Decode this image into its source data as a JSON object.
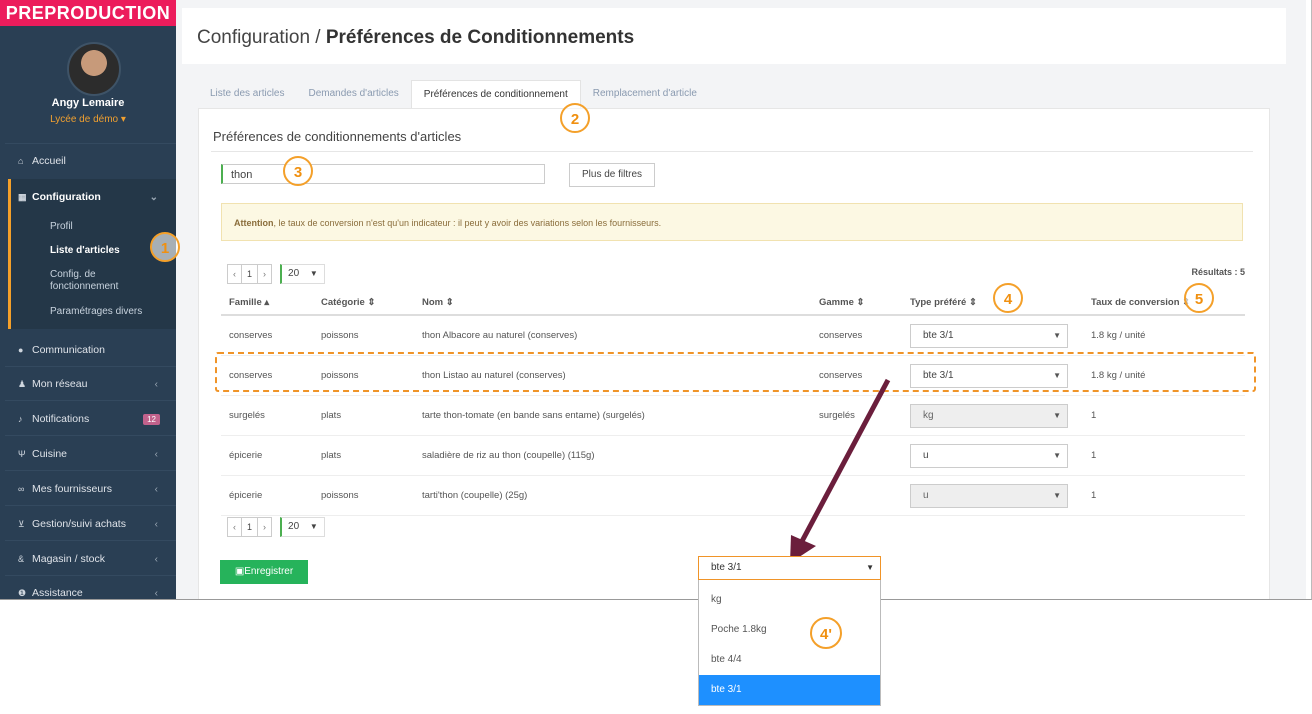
{
  "env_badge": "PREPRODUCTION",
  "user": {
    "name": "Angy Lemaire",
    "school": "Lycée de démo ▾"
  },
  "sidebar": {
    "items": [
      {
        "label": "Accueil",
        "icon": "home-icon"
      },
      {
        "label": "Configuration",
        "icon": "bank-icon"
      },
      {
        "label": "Communication",
        "icon": "chat-icon"
      },
      {
        "label": "Mon réseau",
        "icon": "users-icon"
      },
      {
        "label": "Notifications",
        "icon": "bell-icon",
        "badge": "12"
      },
      {
        "label": "Cuisine",
        "icon": "cutlery-icon"
      },
      {
        "label": "Mes fournisseurs",
        "icon": "handshake-icon"
      },
      {
        "label": "Gestion/suivi achats",
        "icon": "cart-icon"
      },
      {
        "label": "Magasin / stock",
        "icon": "link-icon"
      },
      {
        "label": "Assistance",
        "icon": "info-icon"
      }
    ],
    "config_sub": [
      "Profil",
      "Liste d'articles",
      "Config. de fonctionnement",
      "Paramétrages divers"
    ]
  },
  "header": {
    "crumb": "Configuration / ",
    "title": "Préférences de Conditionnements"
  },
  "tabs": [
    "Liste des articles",
    "Demandes d'articles",
    "Préférences de conditionnement",
    "Remplacement d'article"
  ],
  "panel_title": "Préférences de conditionnements d'articles",
  "search_value": "thon",
  "more_filters": "Plus de filtres",
  "alert": {
    "strong": "Attention",
    "text": ", le taux de conversion n'est qu'un indicateur : il peut y avoir des variations selon les fournisseurs."
  },
  "pager": {
    "prev": "‹",
    "page": "1",
    "next": "›",
    "size": "20"
  },
  "results": "Résultats : 5",
  "columns": [
    "Famille ▴",
    "Catégorie ⇕",
    "Nom ⇕",
    "Gamme ⇕",
    "Type préféré ⇕",
    "Taux de conversion ⇕"
  ],
  "rows": [
    {
      "famille": "conserves",
      "categorie": "poissons",
      "nom": "thon Albacore au naturel (conserves)",
      "gamme": "conserves",
      "type": "bte 3/1",
      "taux": "1.8 kg / unité"
    },
    {
      "famille": "conserves",
      "categorie": "poissons",
      "nom": "thon Listao au naturel (conserves)",
      "gamme": "conserves",
      "type": "bte 3/1",
      "taux": "1.8 kg / unité"
    },
    {
      "famille": "surgelés",
      "categorie": "plats",
      "nom": "tarte thon-tomate (en bande sans entame) (surgelés)",
      "gamme": "surgelés",
      "type": "kg",
      "taux": "1"
    },
    {
      "famille": "épicerie",
      "categorie": "plats",
      "nom": "saladière de riz au thon (coupelle) (115g)",
      "gamme": "",
      "type": "u",
      "taux": "1"
    },
    {
      "famille": "épicerie",
      "categorie": "poissons",
      "nom": "tarti'thon (coupelle) (25g)",
      "gamme": "",
      "type": "u",
      "taux": "1"
    }
  ],
  "save_label": "Enregistrer",
  "dropdown": {
    "current": "bte 3/1",
    "options": [
      "kg",
      "Poche 1.8kg",
      "bte 4/4",
      "bte 3/1"
    ]
  },
  "annotations": {
    "n1": "1",
    "n2": "2",
    "n3": "3",
    "n4": "4",
    "n5": "5",
    "n4p": "4'"
  }
}
